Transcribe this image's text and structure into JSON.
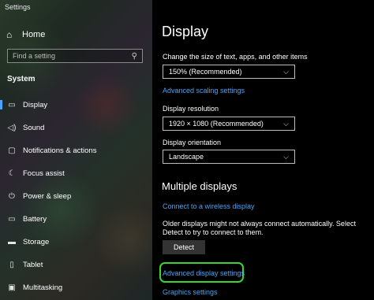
{
  "window": {
    "title": "Settings"
  },
  "sidebar": {
    "home_label": "Home",
    "search": {
      "placeholder": "Find a setting"
    },
    "section_label": "System",
    "items": [
      {
        "label": "Display",
        "icon": "monitor-icon",
        "active": true
      },
      {
        "label": "Sound",
        "icon": "speaker-icon"
      },
      {
        "label": "Notifications & actions",
        "icon": "notification-icon"
      },
      {
        "label": "Focus assist",
        "icon": "moon-icon"
      },
      {
        "label": "Power & sleep",
        "icon": "power-icon"
      },
      {
        "label": "Battery",
        "icon": "battery-icon"
      },
      {
        "label": "Storage",
        "icon": "storage-icon"
      },
      {
        "label": "Tablet",
        "icon": "tablet-icon"
      },
      {
        "label": "Multitasking",
        "icon": "multitasking-icon"
      }
    ]
  },
  "main": {
    "title": "Display",
    "scale": {
      "label": "Change the size of text, apps, and other items",
      "value": "150% (Recommended)",
      "link": "Advanced scaling settings"
    },
    "resolution": {
      "label": "Display resolution",
      "value": "1920 × 1080 (Recommended)"
    },
    "orientation": {
      "label": "Display orientation",
      "value": "Landscape"
    },
    "multiple_displays": {
      "heading": "Multiple displays",
      "wireless_link": "Connect to a wireless display",
      "description": "Older displays might not always connect automatically. Select Detect to try to connect to them.",
      "detect_button": "Detect",
      "advanced_link": "Advanced display settings",
      "graphics_link": "Graphics settings"
    }
  },
  "colors": {
    "accent": "#4da3f0",
    "highlight": "#3ad62e",
    "active_indicator": "#4aa3ff"
  }
}
